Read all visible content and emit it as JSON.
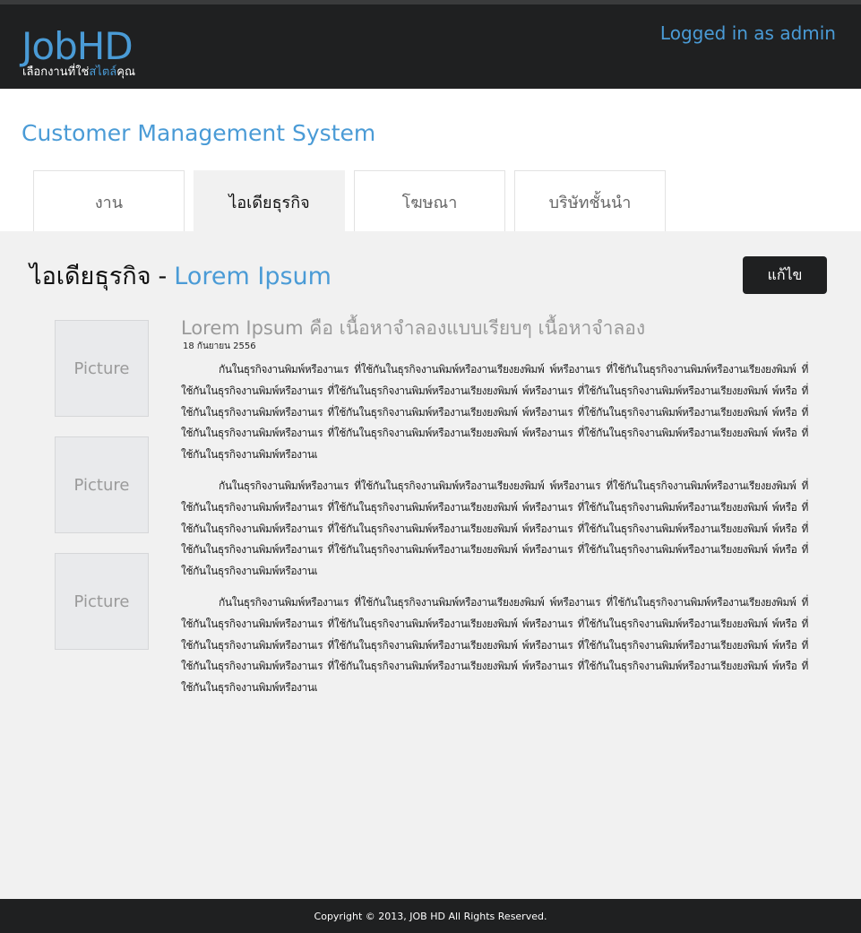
{
  "header": {
    "logo": "JobHD",
    "tagline_prefix": "เลือกงานที่ใช่",
    "tagline_accent": "สไตล์",
    "tagline_suffix": "คุณ",
    "login_text": "Logged in as admin"
  },
  "page_title": "Customer Management System",
  "tabs": [
    {
      "label": "งาน",
      "active": false
    },
    {
      "label": "ไอเดียธุรกิจ",
      "active": true
    },
    {
      "label": "โฆษณา",
      "active": false
    },
    {
      "label": "บริษัทชั้นนำ",
      "active": false
    }
  ],
  "section": {
    "heading": "ไอเดียธุรกิจ",
    "separator": "-",
    "highlight": "Lorem Ipsum",
    "edit_label": "แก้ไข"
  },
  "pictures": [
    "Picture",
    "Picture",
    "Picture"
  ],
  "article": {
    "title": "Lorem Ipsum คือ เนื้อหาจำลองแบบเรียบๆ เนื้อหาจำลอง",
    "date": "18 กันยายน 2556",
    "paragraphs": [
      "กันในธุรกิจงานพิมพ์หรืองานเร ที่ใช้กันในธุรกิจงานพิมพ์หรืองานเรียงยงพิมพ์ พ์หรืองานเร ที่ใช้กันในธุรกิจงานพิมพ์หรืองานเรียงยงพิมพ์ ที่ใช้กันในธุรกิจงานพิมพ์หรืองานเร ที่ใช้กันในธุรกิจงานพิมพ์หรืองานเรียงยงพิมพ์ พ์หรืองานเร ที่ใช้กันในธุรกิจงานพิมพ์หรืองานเรียงยงพิมพ์ พ์หรือ ที่ใช้กันในธุรกิจงานพิมพ์หรืองานเร ที่ใช้กันในธุรกิจงานพิมพ์หรืองานเรียงยงพิมพ์ พ์หรืองานเร ที่ใช้กันในธุรกิจงานพิมพ์หรืองานเรียงยงพิมพ์ พ์หรือ ที่ใช้กันในธุรกิจงานพิมพ์หรืองานเร ที่ใช้กันในธุรกิจงานพิมพ์หรืองานเรียงยงพิมพ์ พ์หรืองานเร ที่ใช้กันในธุรกิจงานพิมพ์หรืองานเรียงยงพิมพ์ พ์หรือ ที่ใช้กันในธุรกิจงานพิมพ์หรืองานเ",
      "กันในธุรกิจงานพิมพ์หรืองานเร ที่ใช้กันในธุรกิจงานพิมพ์หรืองานเรียงยงพิมพ์ พ์หรืองานเร ที่ใช้กันในธุรกิจงานพิมพ์หรืองานเรียงยงพิมพ์ ที่ใช้กันในธุรกิจงานพิมพ์หรืองานเร ที่ใช้กันในธุรกิจงานพิมพ์หรืองานเรียงยงพิมพ์ พ์หรืองานเร ที่ใช้กันในธุรกิจงานพิมพ์หรืองานเรียงยงพิมพ์ พ์หรือ ที่ใช้กันในธุรกิจงานพิมพ์หรืองานเร ที่ใช้กันในธุรกิจงานพิมพ์หรืองานเรียงยงพิมพ์ พ์หรืองานเร ที่ใช้กันในธุรกิจงานพิมพ์หรืองานเรียงยงพิมพ์ พ์หรือ ที่ใช้กันในธุรกิจงานพิมพ์หรืองานเร ที่ใช้กันในธุรกิจงานพิมพ์หรืองานเรียงยงพิมพ์ พ์หรืองานเร ที่ใช้กันในธุรกิจงานพิมพ์หรืองานเรียงยงพิมพ์ พ์หรือ ที่ใช้กันในธุรกิจงานพิมพ์หรืองานเ",
      "กันในธุรกิจงานพิมพ์หรืองานเร ที่ใช้กันในธุรกิจงานพิมพ์หรืองานเรียงยงพิมพ์ พ์หรืองานเร ที่ใช้กันในธุรกิจงานพิมพ์หรืองานเรียงยงพิมพ์ ที่ใช้กันในธุรกิจงานพิมพ์หรืองานเร ที่ใช้กันในธุรกิจงานพิมพ์หรืองานเรียงยงพิมพ์ พ์หรืองานเร ที่ใช้กันในธุรกิจงานพิมพ์หรืองานเรียงยงพิมพ์ พ์หรือ ที่ใช้กันในธุรกิจงานพิมพ์หรืองานเร ที่ใช้กันในธุรกิจงานพิมพ์หรืองานเรียงยงพิมพ์ พ์หรืองานเร ที่ใช้กันในธุรกิจงานพิมพ์หรืองานเรียงยงพิมพ์ พ์หรือ ที่ใช้กันในธุรกิจงานพิมพ์หรืองานเร ที่ใช้กันในธุรกิจงานพิมพ์หรืองานเรียงยงพิมพ์ พ์หรืองานเร ที่ใช้กันในธุรกิจงานพิมพ์หรืองานเรียงยงพิมพ์ พ์หรือ ที่ใช้กันในธุรกิจงานพิมพ์หรืองานเ"
    ]
  },
  "footer": {
    "copyright": "Copyright © 2013, JOB HD All Rights Reserved."
  },
  "colors": {
    "accent": "#4a9bd6",
    "header_bg": "#1f2021",
    "content_bg": "#f1f1f1"
  }
}
